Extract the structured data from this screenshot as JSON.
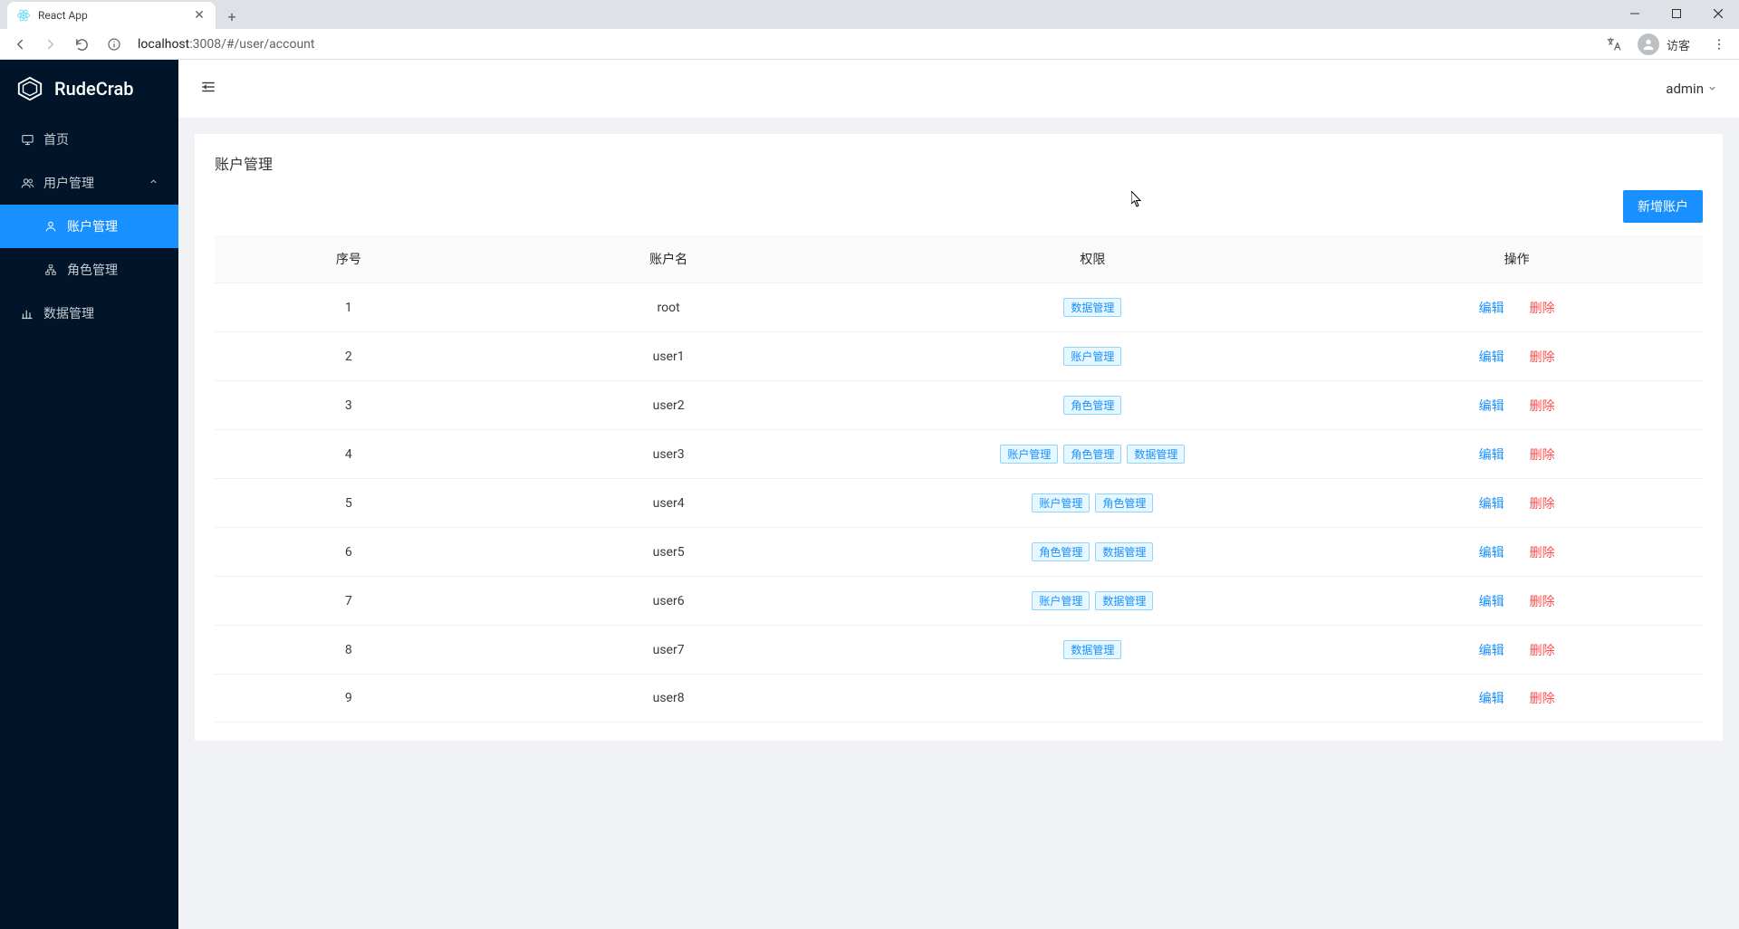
{
  "browser": {
    "tab_title": "React App",
    "url_host": "localhost",
    "url_port": ":3008",
    "url_path": "/#/user/account",
    "guest_label": "访客"
  },
  "sidebar": {
    "brand": "RudeCrab",
    "items": [
      {
        "label": "首页"
      },
      {
        "label": "用户管理"
      },
      {
        "label": "账户管理"
      },
      {
        "label": "角色管理"
      },
      {
        "label": "数据管理"
      }
    ]
  },
  "topbar": {
    "username": "admin"
  },
  "page": {
    "title": "账户管理",
    "add_button": "新增账户",
    "columns": {
      "index": "序号",
      "name": "账户名",
      "perm": "权限",
      "action": "操作"
    },
    "edit_label": "编辑",
    "delete_label": "删除",
    "rows": [
      {
        "index": "1",
        "name": "root",
        "perms": [
          "数据管理"
        ]
      },
      {
        "index": "2",
        "name": "user1",
        "perms": [
          "账户管理"
        ]
      },
      {
        "index": "3",
        "name": "user2",
        "perms": [
          "角色管理"
        ]
      },
      {
        "index": "4",
        "name": "user3",
        "perms": [
          "账户管理",
          "角色管理",
          "数据管理"
        ]
      },
      {
        "index": "5",
        "name": "user4",
        "perms": [
          "账户管理",
          "角色管理"
        ]
      },
      {
        "index": "6",
        "name": "user5",
        "perms": [
          "角色管理",
          "数据管理"
        ]
      },
      {
        "index": "7",
        "name": "user6",
        "perms": [
          "账户管理",
          "数据管理"
        ]
      },
      {
        "index": "8",
        "name": "user7",
        "perms": [
          "数据管理"
        ]
      },
      {
        "index": "9",
        "name": "user8",
        "perms": []
      }
    ]
  }
}
